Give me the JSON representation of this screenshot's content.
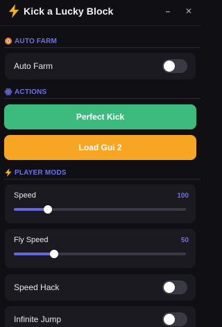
{
  "window": {
    "title": "Kick a Lucky Block",
    "minimize_label": "–",
    "close_label": "✕"
  },
  "colors": {
    "accent": "#6366e0",
    "section": "#6e70e6",
    "green": "#3dbb7e",
    "orange": "#f6a623",
    "bolt": "#f7b21a"
  },
  "sections": {
    "auto_farm": {
      "label": "AUTO FARM",
      "icon": "orange-ring-icon"
    },
    "actions": {
      "label": "ACTIONS",
      "icon": "atom-icon"
    },
    "player_mods": {
      "label": "PLAYER MODS",
      "icon": "lightning-icon"
    }
  },
  "auto_farm": {
    "toggle_label": "Auto Farm",
    "enabled": false
  },
  "actions": {
    "perfect_kick": "Perfect Kick",
    "load_gui": "Load Gui 2"
  },
  "player_mods": {
    "speed": {
      "label": "Speed",
      "value": "100",
      "fraction": 0.175
    },
    "fly_speed": {
      "label": "Fly Speed",
      "value": "50",
      "fraction": 0.21
    },
    "speed_hack": {
      "label": "Speed Hack",
      "enabled": false
    },
    "infinite_jump": {
      "label": "Infinite Jump",
      "enabled": false
    }
  }
}
